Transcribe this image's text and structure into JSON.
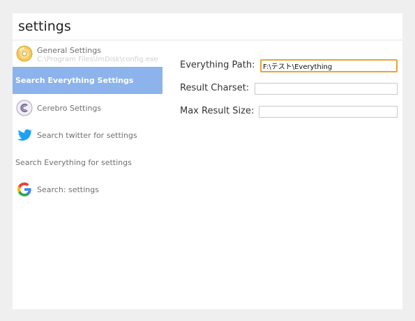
{
  "search": {
    "value": "settings"
  },
  "results": [
    {
      "title": "General Settings",
      "subtitle": "C:\\Program Files\\ImDisk\\config.exe",
      "icon": "imdisk-cd-icon",
      "selected": false
    },
    {
      "title": "Search Everything Settings",
      "icon": "",
      "selected": true
    },
    {
      "title": "Cerebro Settings",
      "icon": "cerebro-icon",
      "selected": false
    },
    {
      "title": "Search twitter for settings",
      "icon": "twitter-icon",
      "selected": false
    },
    {
      "title": "Search Everything for settings",
      "icon": "",
      "selected": false
    },
    {
      "title": "Search: settings",
      "icon": "google-icon",
      "selected": false
    }
  ],
  "preview": {
    "fields": [
      {
        "label": "Everything Path:",
        "value": "F:\\テスト\\Everything"
      },
      {
        "label": "Result Charset:",
        "value": ""
      },
      {
        "label": "Max Result Size:",
        "value": ""
      }
    ]
  },
  "colors": {
    "selected_bg": "#8cb3ec",
    "focus_border": "#e8a23a",
    "twitter_blue": "#1da1f2"
  }
}
